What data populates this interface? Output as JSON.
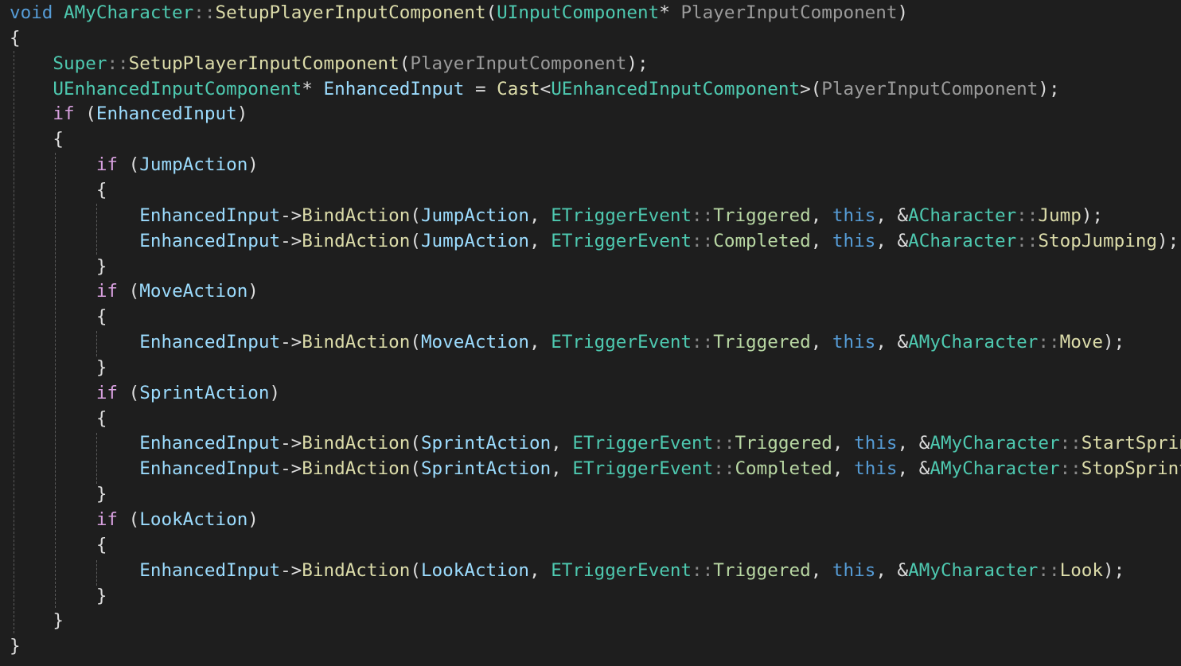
{
  "editor": {
    "theme": {
      "background": "#1e1e1e",
      "keyword": "#569cd6",
      "type": "#4ec9b0",
      "function": "#dcdcaa",
      "parameter": "#9a9a9a",
      "variable": "#9cdcfe",
      "control": "#d8a0df",
      "enum_member": "#b8d7a3",
      "punctuation": "#dcdcdc"
    },
    "lines": [
      [
        {
          "t": "void",
          "c": "kw"
        },
        {
          "t": " ",
          "c": "punc"
        },
        {
          "t": "AMyCharacter",
          "c": "type"
        },
        {
          "t": "::",
          "c": "ns"
        },
        {
          "t": "SetupPlayerInputComponent",
          "c": "fn"
        },
        {
          "t": "(",
          "c": "punc"
        },
        {
          "t": "UInputComponent",
          "c": "type"
        },
        {
          "t": "* ",
          "c": "punc"
        },
        {
          "t": "PlayerInputComponent",
          "c": "param"
        },
        {
          "t": ")",
          "c": "punc"
        }
      ],
      [
        {
          "t": "{",
          "c": "punc"
        }
      ],
      [
        {
          "t": "    ",
          "c": "punc"
        },
        {
          "t": "Super",
          "c": "type"
        },
        {
          "t": "::",
          "c": "ns"
        },
        {
          "t": "SetupPlayerInputComponent",
          "c": "fn"
        },
        {
          "t": "(",
          "c": "punc"
        },
        {
          "t": "PlayerInputComponent",
          "c": "param"
        },
        {
          "t": ");",
          "c": "punc"
        }
      ],
      [
        {
          "t": "    ",
          "c": "punc"
        },
        {
          "t": "UEnhancedInputComponent",
          "c": "type"
        },
        {
          "t": "* ",
          "c": "punc"
        },
        {
          "t": "EnhancedInput",
          "c": "var"
        },
        {
          "t": " = ",
          "c": "punc"
        },
        {
          "t": "Cast",
          "c": "fn"
        },
        {
          "t": "<",
          "c": "punc"
        },
        {
          "t": "UEnhancedInputComponent",
          "c": "type"
        },
        {
          "t": ">(",
          "c": "punc"
        },
        {
          "t": "PlayerInputComponent",
          "c": "param"
        },
        {
          "t": ");",
          "c": "punc"
        }
      ],
      [
        {
          "t": "    ",
          "c": "punc"
        },
        {
          "t": "if",
          "c": "ctrl"
        },
        {
          "t": " (",
          "c": "punc"
        },
        {
          "t": "EnhancedInput",
          "c": "var"
        },
        {
          "t": ")",
          "c": "punc"
        }
      ],
      [
        {
          "t": "    {",
          "c": "punc"
        }
      ],
      [
        {
          "t": "        ",
          "c": "punc"
        },
        {
          "t": "if",
          "c": "ctrl"
        },
        {
          "t": " (",
          "c": "punc"
        },
        {
          "t": "JumpAction",
          "c": "var"
        },
        {
          "t": ")",
          "c": "punc"
        }
      ],
      [
        {
          "t": "        {",
          "c": "punc"
        }
      ],
      [
        {
          "t": "            ",
          "c": "punc"
        },
        {
          "t": "EnhancedInput",
          "c": "var"
        },
        {
          "t": "->",
          "c": "punc"
        },
        {
          "t": "BindAction",
          "c": "fn"
        },
        {
          "t": "(",
          "c": "punc"
        },
        {
          "t": "JumpAction",
          "c": "var"
        },
        {
          "t": ", ",
          "c": "punc"
        },
        {
          "t": "ETriggerEvent",
          "c": "type"
        },
        {
          "t": "::",
          "c": "ns"
        },
        {
          "t": "Triggered",
          "c": "enum"
        },
        {
          "t": ", ",
          "c": "punc"
        },
        {
          "t": "this",
          "c": "kw"
        },
        {
          "t": ", &",
          "c": "punc"
        },
        {
          "t": "ACharacter",
          "c": "type"
        },
        {
          "t": "::",
          "c": "ns"
        },
        {
          "t": "Jump",
          "c": "fn"
        },
        {
          "t": ");",
          "c": "punc"
        }
      ],
      [
        {
          "t": "            ",
          "c": "punc"
        },
        {
          "t": "EnhancedInput",
          "c": "var"
        },
        {
          "t": "->",
          "c": "punc"
        },
        {
          "t": "BindAction",
          "c": "fn"
        },
        {
          "t": "(",
          "c": "punc"
        },
        {
          "t": "JumpAction",
          "c": "var"
        },
        {
          "t": ", ",
          "c": "punc"
        },
        {
          "t": "ETriggerEvent",
          "c": "type"
        },
        {
          "t": "::",
          "c": "ns"
        },
        {
          "t": "Completed",
          "c": "enum"
        },
        {
          "t": ", ",
          "c": "punc"
        },
        {
          "t": "this",
          "c": "kw"
        },
        {
          "t": ", &",
          "c": "punc"
        },
        {
          "t": "ACharacter",
          "c": "type"
        },
        {
          "t": "::",
          "c": "ns"
        },
        {
          "t": "StopJumping",
          "c": "fn"
        },
        {
          "t": ");",
          "c": "punc"
        }
      ],
      [
        {
          "t": "        }",
          "c": "punc"
        }
      ],
      [
        {
          "t": "        ",
          "c": "punc"
        },
        {
          "t": "if",
          "c": "ctrl"
        },
        {
          "t": " (",
          "c": "punc"
        },
        {
          "t": "MoveAction",
          "c": "var"
        },
        {
          "t": ")",
          "c": "punc"
        }
      ],
      [
        {
          "t": "        {",
          "c": "punc"
        }
      ],
      [
        {
          "t": "            ",
          "c": "punc"
        },
        {
          "t": "EnhancedInput",
          "c": "var"
        },
        {
          "t": "->",
          "c": "punc"
        },
        {
          "t": "BindAction",
          "c": "fn"
        },
        {
          "t": "(",
          "c": "punc"
        },
        {
          "t": "MoveAction",
          "c": "var"
        },
        {
          "t": ", ",
          "c": "punc"
        },
        {
          "t": "ETriggerEvent",
          "c": "type"
        },
        {
          "t": "::",
          "c": "ns"
        },
        {
          "t": "Triggered",
          "c": "enum"
        },
        {
          "t": ", ",
          "c": "punc"
        },
        {
          "t": "this",
          "c": "kw"
        },
        {
          "t": ", &",
          "c": "punc"
        },
        {
          "t": "AMyCharacter",
          "c": "type"
        },
        {
          "t": "::",
          "c": "ns"
        },
        {
          "t": "Move",
          "c": "fn"
        },
        {
          "t": ");",
          "c": "punc"
        }
      ],
      [
        {
          "t": "        }",
          "c": "punc"
        }
      ],
      [
        {
          "t": "        ",
          "c": "punc"
        },
        {
          "t": "if",
          "c": "ctrl"
        },
        {
          "t": " (",
          "c": "punc"
        },
        {
          "t": "SprintAction",
          "c": "var"
        },
        {
          "t": ")",
          "c": "punc"
        }
      ],
      [
        {
          "t": "        {",
          "c": "punc"
        }
      ],
      [
        {
          "t": "            ",
          "c": "punc"
        },
        {
          "t": "EnhancedInput",
          "c": "var"
        },
        {
          "t": "->",
          "c": "punc"
        },
        {
          "t": "BindAction",
          "c": "fn"
        },
        {
          "t": "(",
          "c": "punc"
        },
        {
          "t": "SprintAction",
          "c": "var"
        },
        {
          "t": ", ",
          "c": "punc"
        },
        {
          "t": "ETriggerEvent",
          "c": "type"
        },
        {
          "t": "::",
          "c": "ns"
        },
        {
          "t": "Triggered",
          "c": "enum"
        },
        {
          "t": ", ",
          "c": "punc"
        },
        {
          "t": "this",
          "c": "kw"
        },
        {
          "t": ", &",
          "c": "punc"
        },
        {
          "t": "AMyCharacter",
          "c": "type"
        },
        {
          "t": "::",
          "c": "ns"
        },
        {
          "t": "StartSprint",
          "c": "fn"
        },
        {
          "t": ");",
          "c": "punc"
        }
      ],
      [
        {
          "t": "            ",
          "c": "punc"
        },
        {
          "t": "EnhancedInput",
          "c": "var"
        },
        {
          "t": "->",
          "c": "punc"
        },
        {
          "t": "BindAction",
          "c": "fn"
        },
        {
          "t": "(",
          "c": "punc"
        },
        {
          "t": "SprintAction",
          "c": "var"
        },
        {
          "t": ", ",
          "c": "punc"
        },
        {
          "t": "ETriggerEvent",
          "c": "type"
        },
        {
          "t": "::",
          "c": "ns"
        },
        {
          "t": "Completed",
          "c": "enum"
        },
        {
          "t": ", ",
          "c": "punc"
        },
        {
          "t": "this",
          "c": "kw"
        },
        {
          "t": ", &",
          "c": "punc"
        },
        {
          "t": "AMyCharacter",
          "c": "type"
        },
        {
          "t": "::",
          "c": "ns"
        },
        {
          "t": "StopSprint",
          "c": "fn"
        },
        {
          "t": ");",
          "c": "punc"
        }
      ],
      [
        {
          "t": "        }",
          "c": "punc"
        }
      ],
      [
        {
          "t": "        ",
          "c": "punc"
        },
        {
          "t": "if",
          "c": "ctrl"
        },
        {
          "t": " (",
          "c": "punc"
        },
        {
          "t": "LookAction",
          "c": "var"
        },
        {
          "t": ")",
          "c": "punc"
        }
      ],
      [
        {
          "t": "        {",
          "c": "punc"
        }
      ],
      [
        {
          "t": "            ",
          "c": "punc"
        },
        {
          "t": "EnhancedInput",
          "c": "var"
        },
        {
          "t": "->",
          "c": "punc"
        },
        {
          "t": "BindAction",
          "c": "fn"
        },
        {
          "t": "(",
          "c": "punc"
        },
        {
          "t": "LookAction",
          "c": "var"
        },
        {
          "t": ", ",
          "c": "punc"
        },
        {
          "t": "ETriggerEvent",
          "c": "type"
        },
        {
          "t": "::",
          "c": "ns"
        },
        {
          "t": "Triggered",
          "c": "enum"
        },
        {
          "t": ", ",
          "c": "punc"
        },
        {
          "t": "this",
          "c": "kw"
        },
        {
          "t": ", &",
          "c": "punc"
        },
        {
          "t": "AMyCharacter",
          "c": "type"
        },
        {
          "t": "::",
          "c": "ns"
        },
        {
          "t": "Look",
          "c": "fn"
        },
        {
          "t": ");",
          "c": "punc"
        }
      ],
      [
        {
          "t": "        }",
          "c": "punc"
        }
      ],
      [
        {
          "t": "    }",
          "c": "punc"
        }
      ],
      [
        {
          "t": "}",
          "c": "punc"
        }
      ]
    ]
  }
}
